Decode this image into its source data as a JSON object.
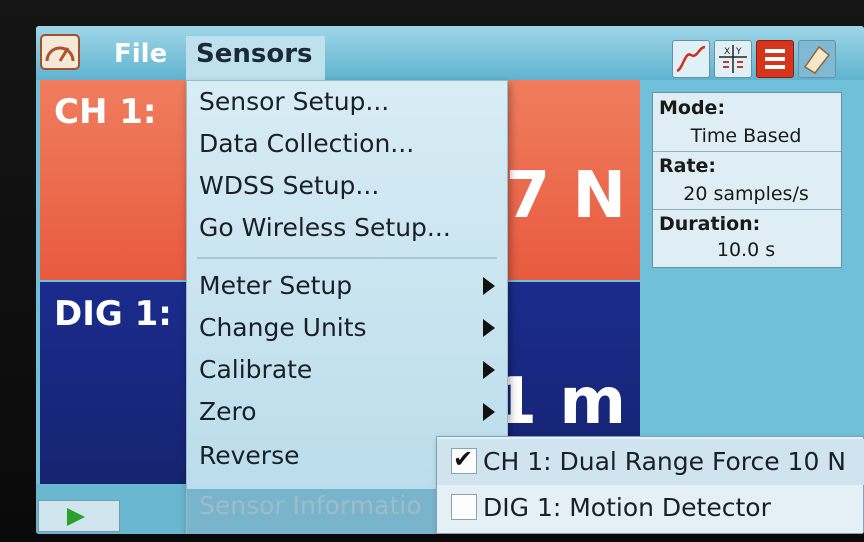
{
  "menubar": {
    "file_label": "File",
    "sensors_label": "Sensors"
  },
  "toolbar": {
    "graph_icon": "graph-icon",
    "table_icon": "table-icon",
    "notes_icon": "notes-icon",
    "journal_icon": "journal-icon"
  },
  "meters": {
    "ch1": {
      "label": "CH 1:",
      "value_visible": "07 N",
      "color": "#e85a3f"
    },
    "dig1": {
      "label": "DIG 1:",
      "value_visible": "1 m",
      "color": "#1b2b8d"
    }
  },
  "info": {
    "mode_label": "Mode:",
    "mode_value": "Time Based",
    "rate_label": "Rate:",
    "rate_value": "20 samples/s",
    "duration_label": "Duration:",
    "duration_value": "10.0 s"
  },
  "sensors_menu": {
    "items": [
      {
        "label": "Sensor Setup..."
      },
      {
        "label": "Data Collection..."
      },
      {
        "label": "WDSS Setup..."
      },
      {
        "label": "Go Wireless Setup..."
      },
      {
        "label": "Meter Setup"
      },
      {
        "label": "Change Units"
      },
      {
        "label": "Calibrate"
      },
      {
        "label": "Zero"
      },
      {
        "label": "Reverse"
      },
      {
        "label": "Sensor Informatio"
      }
    ]
  },
  "reverse_submenu": {
    "items": [
      {
        "label": "CH 1: Dual Range Force 10 N",
        "checked": true
      },
      {
        "label": "DIG 1: Motion Detector",
        "checked": false
      }
    ]
  },
  "bottom": {
    "collect_icon": "play-icon"
  }
}
